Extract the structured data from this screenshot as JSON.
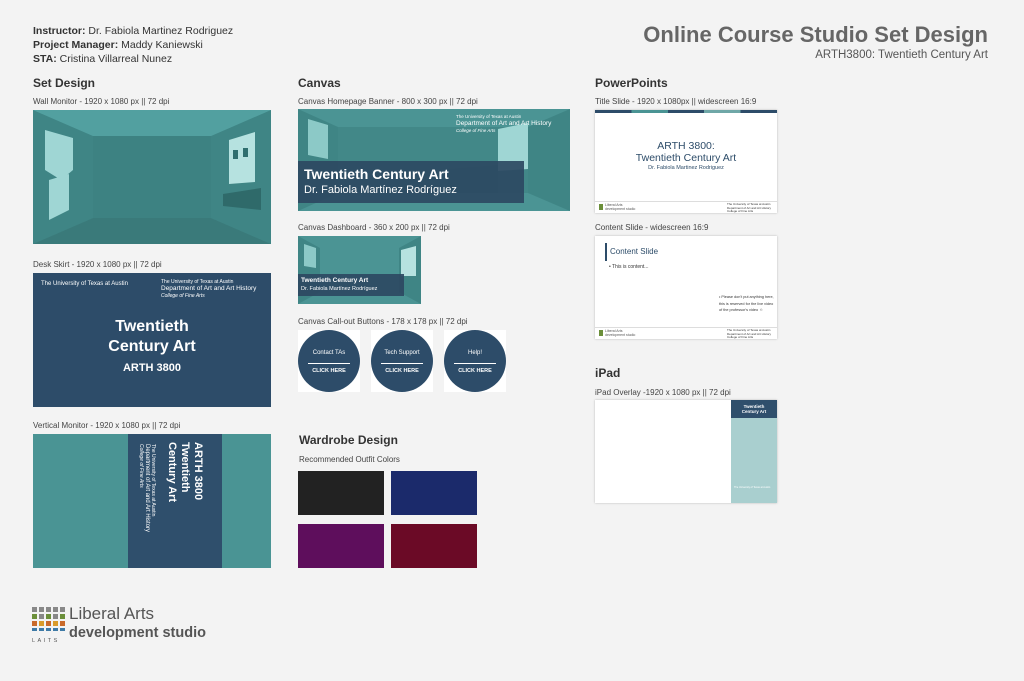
{
  "credits": {
    "instructor_label": "Instructor:",
    "instructor": "Dr. Fabiola Martinez Rodriguez",
    "pm_label": "Project Manager:",
    "pm": "Maddy Kaniewski",
    "sta_label": "STA:",
    "sta": "Cristina Villarreal Nunez"
  },
  "header": {
    "title": "Online Course Studio Set Design",
    "subtitle": "ARTH3800: Twentieth Century Art"
  },
  "set_design": {
    "heading": "Set Design",
    "wall_monitor": "Wall Monitor - 1920 x 1080 px || 72 dpi",
    "desk_skirt": "Desk Skirt - 1920 x 1080 px || 72 dpi",
    "desk_ut": "The University of Texas at Austin",
    "desk_ut2": "The University of Texas at Austin",
    "desk_dept": "Department of Art and Art History",
    "desk_college": "College of Fine Arts",
    "desk_title_1": "Twentieth",
    "desk_title_2": "Century Art",
    "desk_course": "ARTH 3800",
    "vertical_monitor": "Vertical Monitor - 1920 x 1080 px || 72 dpi",
    "vert_title_1": "ARTH 3800",
    "vert_title_2": "Twentieth",
    "vert_title_3": "Century Art",
    "vert_ut": "The University of Texas at Austin",
    "vert_dept": "Department of Art and Art History",
    "vert_college": "College of Fine Arts"
  },
  "canvas": {
    "heading": "Canvas",
    "banner_caption": "Canvas Homepage Banner - 800 x 300 px || 72 dpi",
    "banner_ut": "The University of Texas at Austin",
    "banner_dept": "Department of Art and Art History",
    "banner_college": "College of Fine Arts",
    "banner_title": "Twentieth Century Art",
    "banner_name": "Dr. Fabiola Martínez Rodríguez",
    "dashboard_caption": "Canvas Dashboard - 360 x 200 px || 72 dpi",
    "dash_title": "Twentieth Century Art",
    "dash_name": "Dr. Fabiola Martínez Rodríguez",
    "callout_caption": "Canvas Call-out Buttons - 178 x 178 px || 72 dpi",
    "buttons": [
      {
        "label": "Contact TAs",
        "cta": "CLICK HERE"
      },
      {
        "label": "Tech Support",
        "cta": "CLICK HERE"
      },
      {
        "label": "Help!",
        "cta": "CLICK HERE"
      }
    ]
  },
  "wardrobe": {
    "heading": "Wardrobe Design",
    "caption": "Recommended Outfit Colors",
    "colors": [
      "#222222",
      "#1b2a6b",
      "#5e0e5c",
      "#6b0a26"
    ]
  },
  "powerpoints": {
    "heading": "PowerPoints",
    "title_caption": "Title Slide - 1920 x 1080px || widescreen 16:9",
    "title_line1": "ARTH 3800:",
    "title_line2": "Twentieth Century Art",
    "title_name": "Dr. Fabiola Martinez Rodriguez",
    "footer_left_1": "Liberal Arts",
    "footer_left_2": "development studio",
    "footer_right_1": "The University of Texas at Austin",
    "footer_right_2": "Department of Art and Art History",
    "footer_right_3": "College of Fine Arts",
    "content_caption": "Content Slide - widescreen 16:9",
    "content_title": "Content Slide",
    "content_bullet": "• This is content...",
    "content_note": "• Please don't put anything here, this is reserved for the live video of the professor's video ☺"
  },
  "ipad": {
    "heading": "iPad",
    "caption": "iPad Overlay -1920 x 1080 px || 72 dpi",
    "overlay_title_1": "Twentieth",
    "overlay_title_2": "Century Art",
    "overlay_ut": "The University of Texas at Austin"
  },
  "logo": {
    "line1": "Liberal Arts",
    "line2": "development studio",
    "mark": "LAITS"
  }
}
